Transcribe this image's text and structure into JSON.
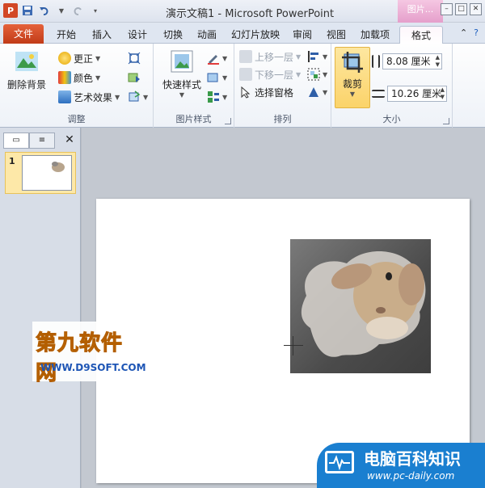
{
  "titlebar": {
    "app_icon_letter": "P",
    "title": "演示文稿1 - Microsoft PowerPoint",
    "context_tab_title": "图片...",
    "controls": [
      "–",
      "□",
      "✕"
    ]
  },
  "tabs": {
    "file": "文件",
    "items": [
      "开始",
      "插入",
      "设计",
      "切换",
      "动画",
      "幻灯片放映",
      "审阅",
      "视图",
      "加载项"
    ],
    "active": "格式"
  },
  "ribbon": {
    "adjust": {
      "remove_bg": "删除背景",
      "corrections": "更正",
      "color": "颜色",
      "artistic": "艺术效果",
      "label": "调整"
    },
    "styles": {
      "quick_styles": "快速样式",
      "label": "图片样式"
    },
    "arrange": {
      "bring_forward": "上移一层",
      "send_backward": "下移一层",
      "selection_pane": "选择窗格",
      "label": "排列"
    },
    "size": {
      "crop": "裁剪",
      "height": "8.08 厘米",
      "width": "10.26 厘米",
      "label": "大小"
    }
  },
  "leftpane": {
    "slide_number": "1"
  },
  "watermarks": {
    "site1_title": "第九软件网",
    "site1_url": "WWW.D9SOFT.COM",
    "site2_title": "电脑百科知识",
    "site2_url": "www.pc-daily.com"
  },
  "colors": {
    "file_tab": "#c13b18",
    "context_tab": "#e59fcb",
    "crop_active": "#fbd36a"
  }
}
